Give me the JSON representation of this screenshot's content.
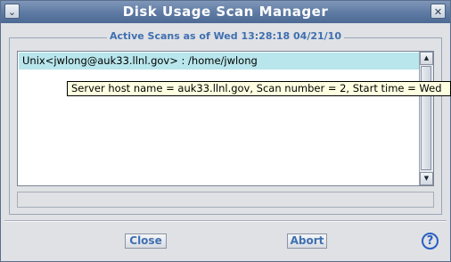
{
  "window": {
    "title": "Disk Usage Scan Manager",
    "menu_icon": "chevron-down-icon",
    "close_icon": "close-icon",
    "close_glyph": "✕",
    "menu_glyph": "⌄"
  },
  "group": {
    "title": "Active Scans as of Wed 13:28:18 04/21/10"
  },
  "scans": [
    {
      "label": "Unix<jwlong@auk33.llnl.gov> : /home/jwlong"
    }
  ],
  "tooltip": {
    "text": "Server host name = auk33.llnl.gov,  Scan number = 2,  Start time = Wed"
  },
  "buttons": {
    "close": "Close",
    "abort": "Abort",
    "help": "?"
  },
  "colors": {
    "accent": "#3f6fb0",
    "selected_row": "#b8e6ec",
    "tooltip_bg": "#ffffe1"
  }
}
